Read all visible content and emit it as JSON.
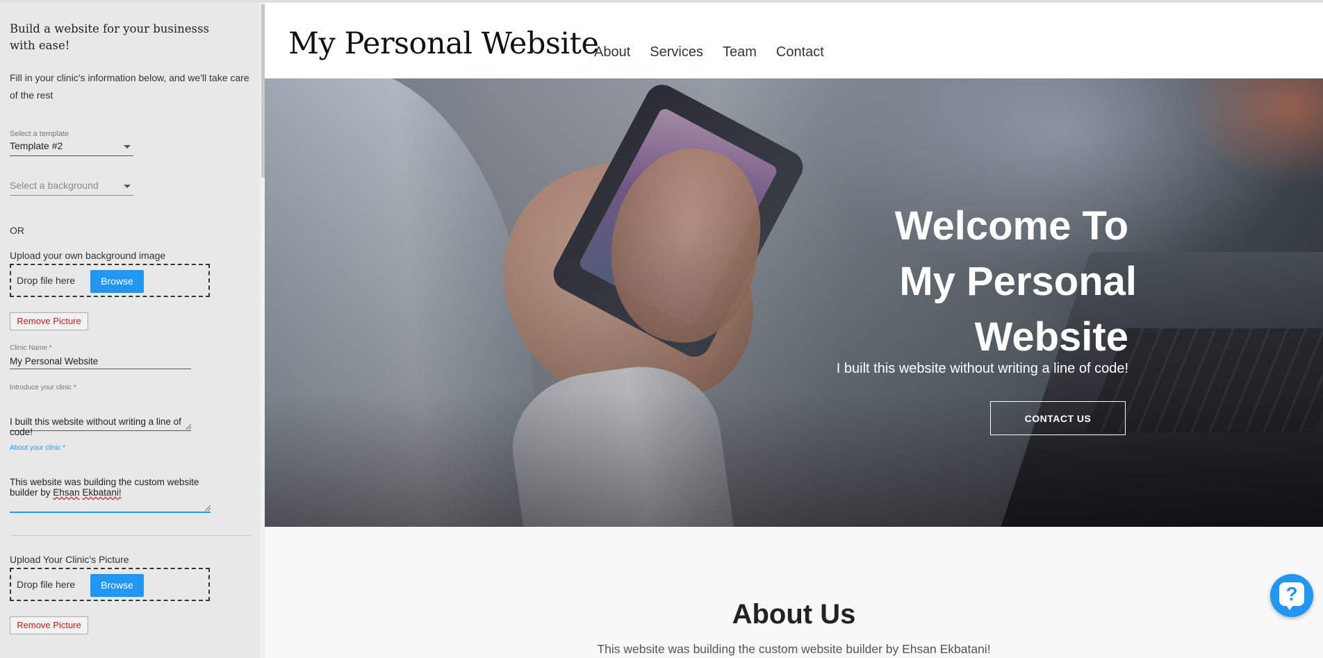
{
  "sidebar": {
    "title": "Build a website for your businesss with ease!",
    "intro": "Fill in your clinic's information below, and we'll take care of the rest",
    "template": {
      "label": "Select a template",
      "value": "Template #2"
    },
    "background": {
      "placeholder": "Select a background"
    },
    "or_text": "OR",
    "bg_upload": {
      "label": "Upload your own background image",
      "drop_text": "Drop file here",
      "browse_label": "Browse",
      "remove_label": "Remove Picture"
    },
    "clinic_name": {
      "label": "Clinic Name *",
      "value": "My Personal Website"
    },
    "introduce": {
      "label": "Introduce your clinic *",
      "value": "I built this website without writing a line of code!"
    },
    "about": {
      "label": "About your clinic *",
      "value_prefix": "This website was building the custom website builder by ",
      "value_flag1": "Ehsan",
      "value_flag2": "Ekbatani!"
    },
    "pic_upload": {
      "label": "Upload Your Clinic's Picture",
      "drop_text": "Drop file here",
      "browse_label": "Browse",
      "remove_label": "Remove Picture"
    }
  },
  "site": {
    "logo": "My Personal Website",
    "nav": [
      "About",
      "Services",
      "Team",
      "Contact"
    ],
    "hero": {
      "title_lines": [
        "Welcome To",
        "My Personal",
        "Website"
      ],
      "subtitle": "I built this website without writing a line of code!",
      "cta": "CONTACT US"
    },
    "about": {
      "title": "About Us",
      "text": "This website was building the custom website builder by Ehsan Ekbatani!"
    }
  },
  "help_widget": {
    "icon": "question-icon",
    "glyph": "?"
  },
  "colors": {
    "accent": "#2196f3",
    "remove": "#b71c1c"
  }
}
